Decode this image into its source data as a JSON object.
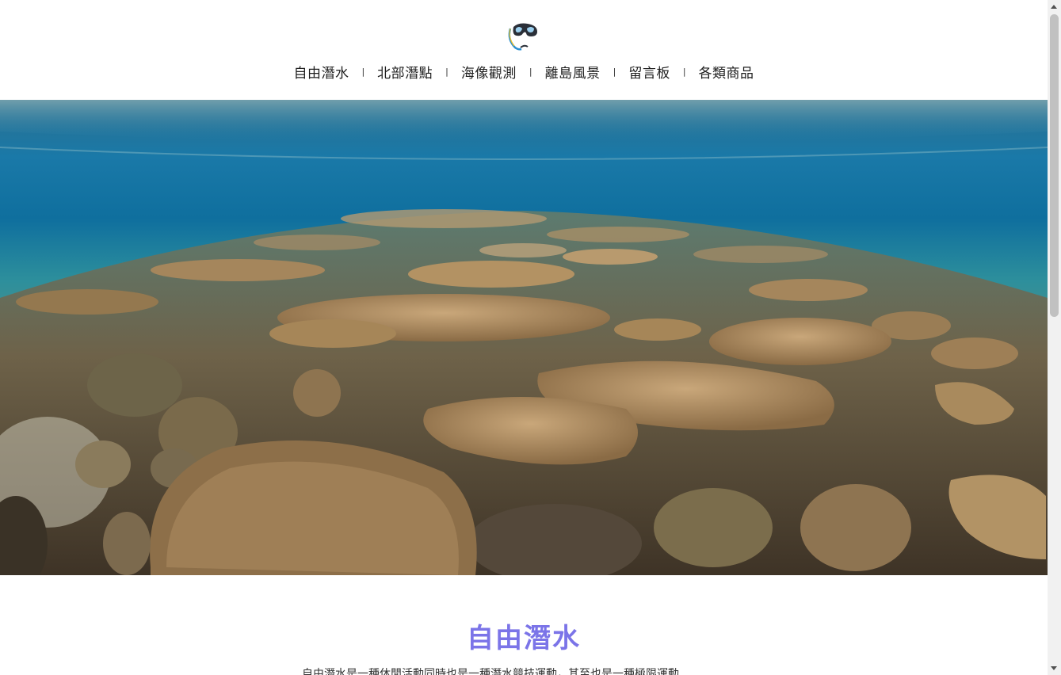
{
  "header": {
    "logo_icon": "snorkel-mask-icon",
    "nav": [
      {
        "label": "自由潛水"
      },
      {
        "label": "北部潛點"
      },
      {
        "label": "海像觀測"
      },
      {
        "label": "離島風景"
      },
      {
        "label": "留言板"
      },
      {
        "label": "各類商品"
      }
    ],
    "separator": "|"
  },
  "hero": {
    "image": "underwater-coral-reef-photo"
  },
  "section": {
    "title": "自由潛水",
    "text": "自由潛水是一種休閒活動同時也是一種潛水競技運動，其至也是一種極限運動"
  },
  "colors": {
    "accent": "#7b74e8",
    "nav_text": "#1d1d1d",
    "water_top": "#1f6f9a",
    "coral": "#a8875a"
  }
}
